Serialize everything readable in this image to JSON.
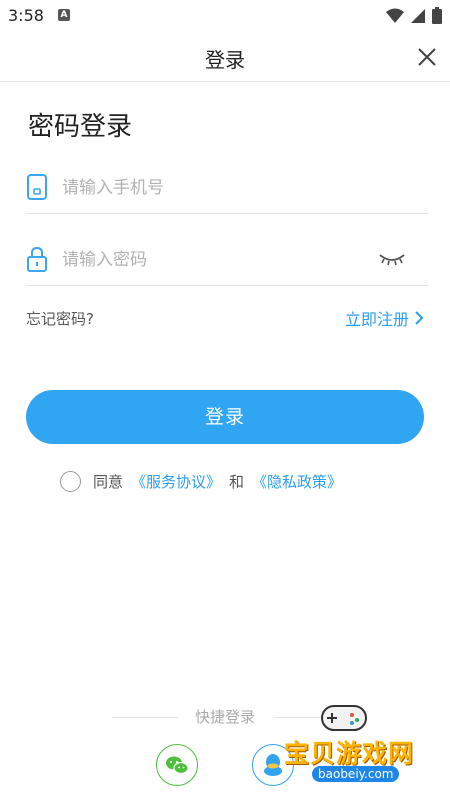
{
  "status_bar": {
    "time": "3:58",
    "notif_letter": "A"
  },
  "header": {
    "title": "登录"
  },
  "page": {
    "heading": "密码登录"
  },
  "phone_field": {
    "placeholder": "请输入手机号",
    "value": ""
  },
  "password_field": {
    "placeholder": "请输入密码",
    "value": ""
  },
  "links": {
    "forgot": "忘记密码?",
    "register": "立即注册"
  },
  "login_button": {
    "label": "登录"
  },
  "agreement": {
    "prefix": "同意",
    "service": "《服务协议》",
    "and": "和",
    "privacy": "《隐私政策》"
  },
  "quick_login": {
    "label": "快捷登录",
    "providers": [
      "wechat-icon",
      "qq-icon"
    ]
  },
  "watermark": {
    "title": "宝贝游戏网",
    "url": "baobeiy.com"
  },
  "colors": {
    "accent": "#30a5f2",
    "link": "#2b9ff0",
    "wechat": "#4cbf3c",
    "qq": "#32a3ef"
  }
}
